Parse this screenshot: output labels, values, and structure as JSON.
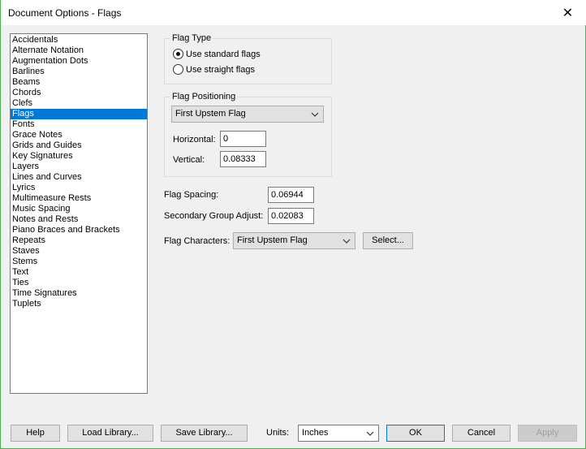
{
  "window": {
    "title": "Document Options - Flags",
    "close_glyph": "✕"
  },
  "sidebar": {
    "items": [
      {
        "label": "Accidentals",
        "selected": false
      },
      {
        "label": "Alternate Notation",
        "selected": false
      },
      {
        "label": "Augmentation Dots",
        "selected": false
      },
      {
        "label": "Barlines",
        "selected": false
      },
      {
        "label": "Beams",
        "selected": false
      },
      {
        "label": "Chords",
        "selected": false
      },
      {
        "label": "Clefs",
        "selected": false
      },
      {
        "label": "Flags",
        "selected": true
      },
      {
        "label": "Fonts",
        "selected": false
      },
      {
        "label": "Grace Notes",
        "selected": false
      },
      {
        "label": "Grids and Guides",
        "selected": false
      },
      {
        "label": "Key Signatures",
        "selected": false
      },
      {
        "label": "Layers",
        "selected": false
      },
      {
        "label": "Lines and Curves",
        "selected": false
      },
      {
        "label": "Lyrics",
        "selected": false
      },
      {
        "label": "Multimeasure Rests",
        "selected": false
      },
      {
        "label": "Music Spacing",
        "selected": false
      },
      {
        "label": "Notes and Rests",
        "selected": false
      },
      {
        "label": "Piano Braces and Brackets",
        "selected": false
      },
      {
        "label": "Repeats",
        "selected": false
      },
      {
        "label": "Staves",
        "selected": false
      },
      {
        "label": "Stems",
        "selected": false
      },
      {
        "label": "Text",
        "selected": false
      },
      {
        "label": "Ties",
        "selected": false
      },
      {
        "label": "Time Signatures",
        "selected": false
      },
      {
        "label": "Tuplets",
        "selected": false
      }
    ]
  },
  "flag_type": {
    "legend": "Flag Type",
    "standard_label": "Use standard flags",
    "straight_label": "Use straight flags",
    "selected": "standard"
  },
  "flag_positioning": {
    "legend": "Flag Positioning",
    "dropdown_value": "First Upstem Flag",
    "horizontal_label": "Horizontal:",
    "horizontal_value": "0",
    "vertical_label": "Vertical:",
    "vertical_value": "0.08333"
  },
  "spacing": {
    "flag_spacing_label": "Flag Spacing:",
    "flag_spacing_value": "0.06944",
    "secondary_label": "Secondary Group Adjust:",
    "secondary_value": "0.02083",
    "characters_label": "Flag Characters:",
    "characters_value": "First Upstem Flag",
    "select_label": "Select..."
  },
  "footer": {
    "help_label": "Help",
    "load_label": "Load Library...",
    "save_label": "Save Library...",
    "units_label": "Units:",
    "units_value": "Inches",
    "ok_label": "OK",
    "cancel_label": "Cancel",
    "apply_label": "Apply"
  }
}
